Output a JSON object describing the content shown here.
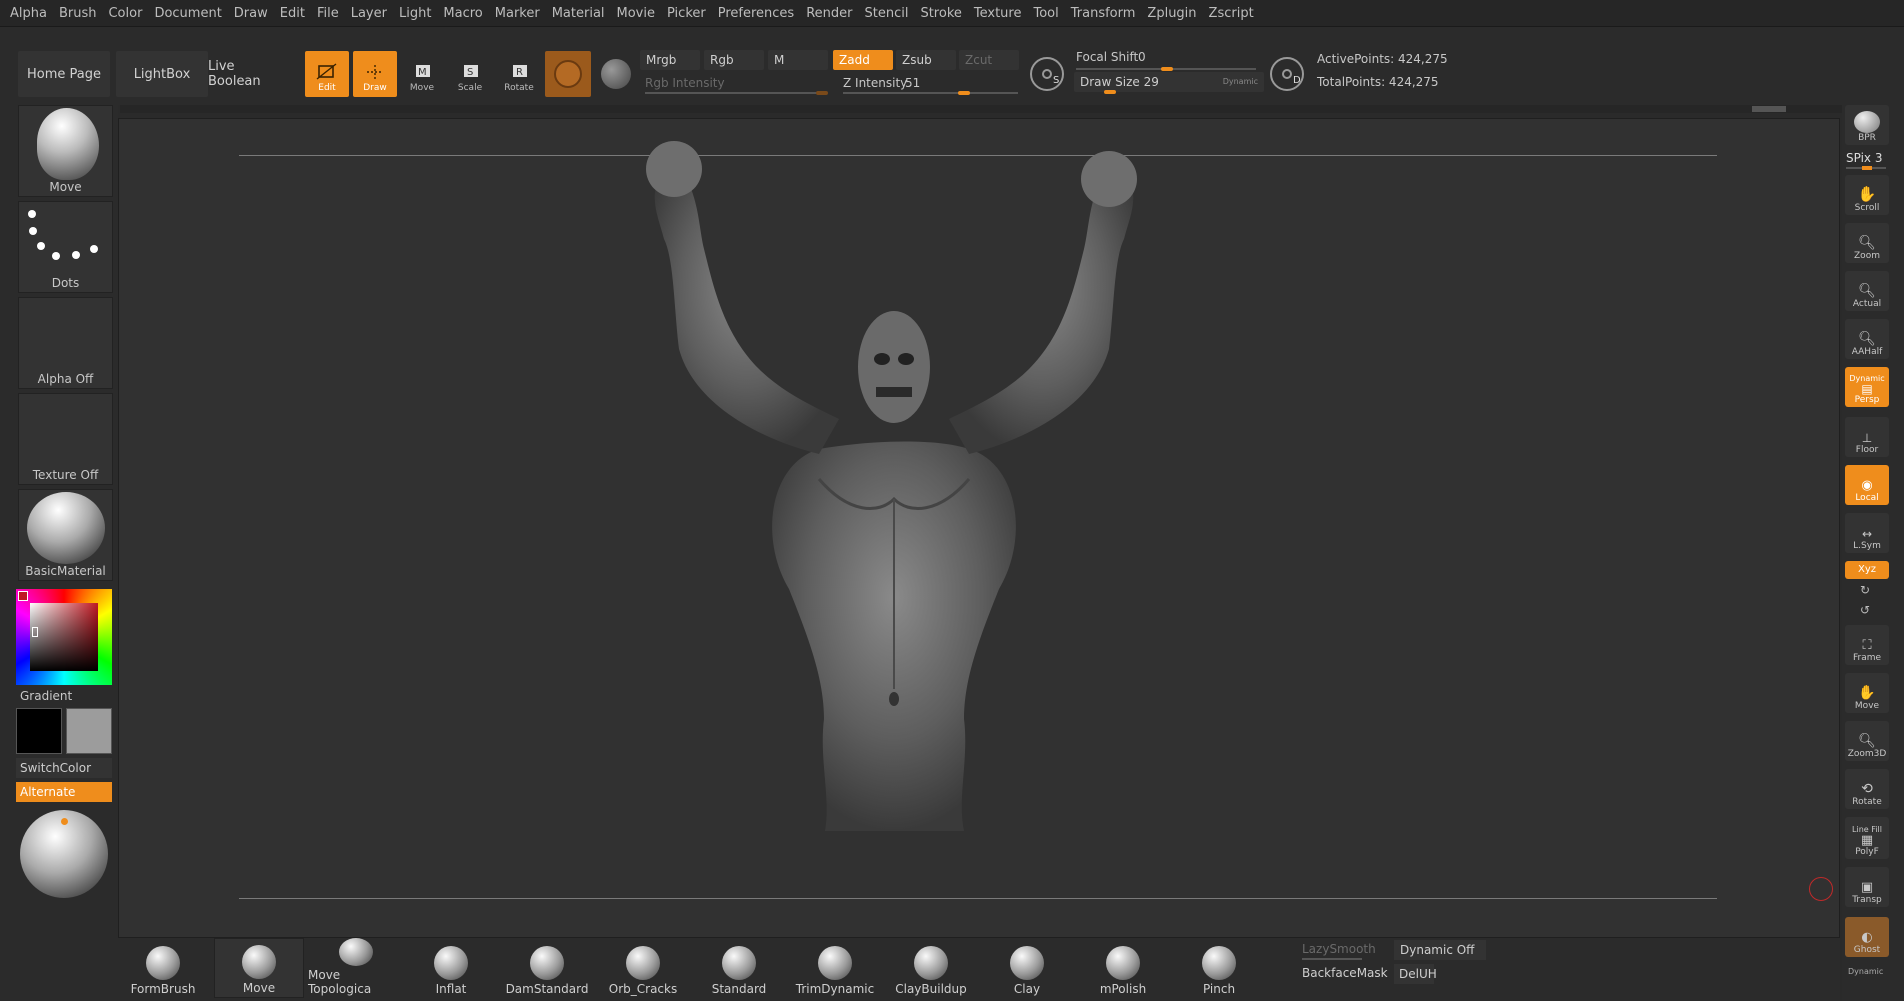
{
  "menu": [
    "Alpha",
    "Brush",
    "Color",
    "Document",
    "Draw",
    "Edit",
    "File",
    "Layer",
    "Light",
    "Macro",
    "Marker",
    "Material",
    "Movie",
    "Picker",
    "Preferences",
    "Render",
    "Stencil",
    "Stroke",
    "Texture",
    "Tool",
    "Transform",
    "Zplugin",
    "Zscript"
  ],
  "toolbar": {
    "home_page": "Home Page",
    "lightbox": "LightBox",
    "live_boolean": "Live Boolean",
    "edit": "Edit",
    "draw": "Draw",
    "move": "Move",
    "scale": "Scale",
    "rotate": "Rotate",
    "mrgb": "Mrgb",
    "rgb": "Rgb",
    "m": "M",
    "rgb_intensity": "Rgb Intensity",
    "zadd": "Zadd",
    "zsub": "Zsub",
    "zcut": "Zcut",
    "z_intensity_label": "Z Intensity",
    "z_intensity_value": "51",
    "focal_shift_label": "Focal Shift",
    "focal_shift_value": "0",
    "draw_size_label": "Draw Size",
    "draw_size_value": "29",
    "dynamic": "Dynamic",
    "dial_s": "S",
    "dial_d": "D",
    "active_points": "ActivePoints: 424,275",
    "total_points": "TotalPoints: 424,275"
  },
  "left": {
    "brush": "Move",
    "stroke": "Dots",
    "alpha": "Alpha Off",
    "texture": "Texture Off",
    "material": "BasicMaterial",
    "gradient": "Gradient",
    "switch_color": "SwitchColor",
    "alternate": "Alternate"
  },
  "right": {
    "bpr": "BPR",
    "spix": "SPix 3",
    "scroll": "Scroll",
    "zoom": "Zoom",
    "actual": "Actual",
    "aahalf": "AAHalf",
    "persp_top": "Dynamic",
    "persp": "Persp",
    "floor": "Floor",
    "local": "Local",
    "lsym": "L.Sym",
    "xyz": "Xyz",
    "frame": "Frame",
    "move": "Move",
    "zoom3d": "Zoom3D",
    "rotate": "Rotate",
    "polyf_top": "Line Fill",
    "polyf": "PolyF",
    "transp": "Transp",
    "ghost": "Ghost",
    "bottom": "Dynamic"
  },
  "shelf": {
    "brushes": [
      "FormBrush",
      "Move",
      "Move Topologica",
      "Inflat",
      "DamStandard",
      "Orb_Cracks",
      "Standard",
      "TrimDynamic",
      "ClayBuildup",
      "Clay",
      "mPolish",
      "Pinch"
    ],
    "lazy_smooth": "LazySmooth",
    "dynamic_off": "Dynamic Off",
    "backface_mask": "BackfaceMask",
    "deluh": "DelUH"
  }
}
